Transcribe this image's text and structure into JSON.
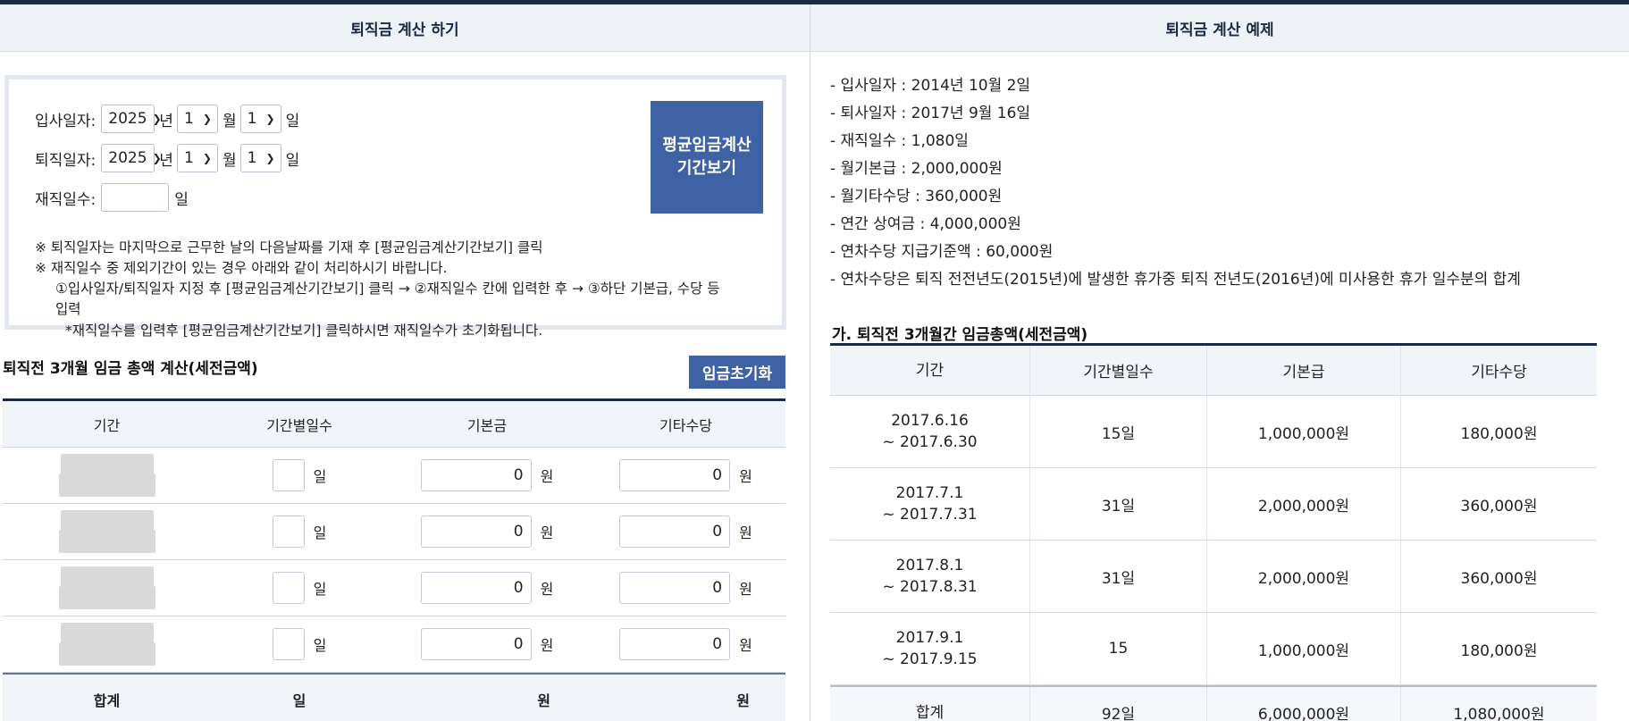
{
  "left_panel": {
    "title": "퇴직금 계산 하기",
    "join_label": "입사일자:",
    "leave_label": "퇴직일자:",
    "service_label": "재직일수:",
    "year_value": "2025",
    "month_value": "1",
    "day_value": "1",
    "unit_year": "년",
    "unit_month": "월",
    "unit_day": "일",
    "avg_button_line1": "평균임금계산",
    "avg_button_line2": "기간보기",
    "note1": "※ 퇴직일자는 마지막으로 근무한 날의 다음날짜를 기재 후 [평균임금계산기간보기] 클릭",
    "note2": "※ 재직일수 중 제외기간이 있는 경우 아래와 같이 처리하시기 바랍니다.",
    "note3": "①입사일자/퇴직일자 지정 후 [평균임금계산기간보기] 클릭 → ②재직일수 칸에 입력한 후 → ③하단 기본급, 수당 등",
    "note4": "입력",
    "note5": "*재직일수를 입력후 [평균임금계산기간보기] 클릭하시면 재직일수가 초기화됩니다.",
    "table_title": "퇴직전 3개월 임금 총액 계산(세전금액)",
    "reset_button": "임금초기화",
    "headers": [
      "기간",
      "기간별일수",
      "기본금",
      "기타수당"
    ],
    "rows": [
      {
        "days_unit": "일",
        "basic": "0",
        "basic_unit": "원",
        "other": "0",
        "other_unit": "원"
      },
      {
        "days_unit": "일",
        "basic": "0",
        "basic_unit": "원",
        "other": "0",
        "other_unit": "원"
      },
      {
        "days_unit": "일",
        "basic": "0",
        "basic_unit": "원",
        "other": "0",
        "other_unit": "원"
      },
      {
        "days_unit": "일",
        "basic": "0",
        "basic_unit": "원",
        "other": "0",
        "other_unit": "원"
      }
    ],
    "footer": [
      "합계",
      "일",
      "원",
      "원"
    ]
  },
  "right_panel": {
    "title": "퇴직금 계산 예제",
    "example_items": [
      "- 입사일자 : 2014년 10월 2일",
      "- 퇴사일자 : 2017년 9월 16일",
      "- 재직일수 : 1,080일",
      "- 월기본급 : 2,000,000원",
      "- 월기타수당 : 360,000원",
      "- 연간 상여금 : 4,000,000원",
      "- 연차수당 지급기준액 : 60,000원",
      "- 연차수당은 퇴직 전전년도(2015년)에 발생한 휴가중 퇴직 전년도(2016년)에 미사용한 휴가 일수분의 합계"
    ],
    "table_title": "가. 퇴직전 3개월간 임금총액(세전금액)",
    "headers": [
      "기간",
      "기간별일수",
      "기본급",
      "기타수당"
    ],
    "rows": [
      {
        "from": "2017.6.16",
        "to": "~ 2017.6.30",
        "days": "15일",
        "basic": "1,000,000원",
        "other": "180,000원"
      },
      {
        "from": "2017.7.1",
        "to": "~ 2017.7.31",
        "days": "31일",
        "basic": "2,000,000원",
        "other": "360,000원"
      },
      {
        "from": "2017.8.1",
        "to": "~ 2017.8.31",
        "days": "31일",
        "basic": "2,000,000원",
        "other": "360,000원"
      },
      {
        "from": "2017.9.1",
        "to": "~ 2017.9.15",
        "days": "15",
        "basic": "1,000,000원",
        "other": "180,000원"
      }
    ],
    "footer": [
      "합계",
      "92일",
      "6,000,000원",
      "1,080,000원"
    ]
  },
  "icons": {
    "dropdown": "chevron-down-icon"
  },
  "colors": {
    "accent_button": "#3e62a4",
    "header_bg": "#eef2f7",
    "rule": "#1b2a40"
  }
}
